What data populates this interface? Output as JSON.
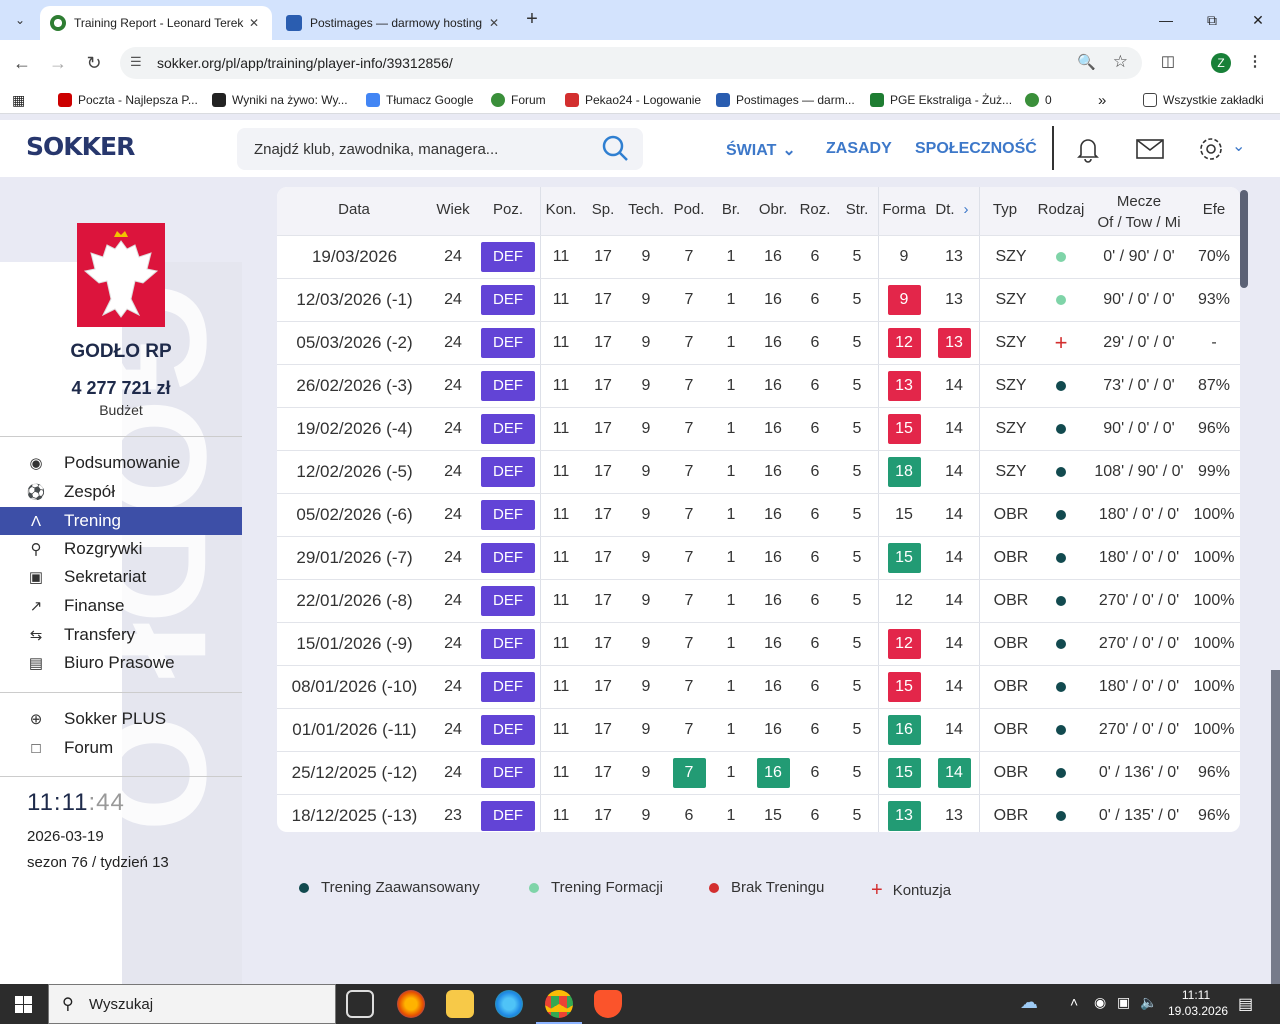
{
  "browser": {
    "tabs": [
      {
        "title": "Training Report - Leonard Terek",
        "active": true
      },
      {
        "title": "Postimages — darmowy hosting",
        "active": false
      }
    ],
    "url": "sokker.org/pl/app/training/player-info/39312856/",
    "profile_initial": "Z",
    "bookmarks": [
      {
        "label": "Poczta - Najlepsza P...",
        "icon": "wp-icon",
        "color": "#c00"
      },
      {
        "label": "Wyniki na żywo: Wy...",
        "icon": "livescore-icon",
        "color": "#222"
      },
      {
        "label": "Tłumacz Google",
        "icon": "translate-icon",
        "color": "#4285f4"
      },
      {
        "label": "Forum",
        "icon": "ball-icon",
        "color": "#3a8f3a"
      },
      {
        "label": "Pekao24 - Logowanie",
        "icon": "pekao-icon",
        "color": "#d32f2f"
      },
      {
        "label": "Postimages — darm...",
        "icon": "postimages-icon",
        "color": "#2a5db0"
      },
      {
        "label": "PGE Ekstraliga - Żuż...",
        "icon": "pge-icon",
        "color": "#1e7d32"
      },
      {
        "label": "0",
        "icon": "ball-icon",
        "color": "#3a8f3a"
      }
    ],
    "all_bookmarks_label": "Wszystkie zakładki"
  },
  "site": {
    "logo": "SOKKER",
    "search_placeholder": "Znajdź klub, zawodnika, managera...",
    "menu": {
      "world": "ŚWIAT",
      "rules": "ZASADY",
      "community": "SPOŁECZNOŚĆ"
    }
  },
  "sidebar": {
    "club_name": "GODŁO RP",
    "budget": "4 277 721 zł",
    "budget_label": "Budżet",
    "watermark": "GODŁO",
    "nav": [
      {
        "label": "Podsumowanie",
        "icon": "medal-icon"
      },
      {
        "label": "Zespół",
        "icon": "ball-icon"
      },
      {
        "label": "Trening",
        "icon": "cone-icon",
        "active": true
      },
      {
        "label": "Rozgrywki",
        "icon": "trophy-icon"
      },
      {
        "label": "Sekretariat",
        "icon": "briefcase-icon"
      },
      {
        "label": "Finanse",
        "icon": "chart-icon"
      },
      {
        "label": "Transfery",
        "icon": "transfer-icon"
      },
      {
        "label": "Biuro Prasowe",
        "icon": "newspaper-icon"
      }
    ],
    "nav2": [
      {
        "label": "Sokker PLUS",
        "icon": "plus-circle-icon"
      },
      {
        "label": "Forum",
        "icon": "chat-icon"
      }
    ],
    "clock": {
      "hm": "11:11",
      "sec": ":44"
    },
    "date": "2026-03-19",
    "season": "sezon 76 / tydzień 13"
  },
  "table": {
    "headers": {
      "date": "Data",
      "age": "Wiek",
      "pos": "Poz.",
      "stamina": "Kon.",
      "pace": "Sp.",
      "technique": "Tech.",
      "passing": "Pod.",
      "keeper": "Br.",
      "defender": "Obr.",
      "playmaker": "Roz.",
      "striker": "Str.",
      "form": "Forma",
      "tactical": "Dt.",
      "type": "Typ",
      "kind": "Rodzaj",
      "matches_l1": "Mecze",
      "matches_l2": "Of / Tow / Mi",
      "eff": "Efe"
    },
    "colors": {
      "pos": "#6244d6",
      "red": "#e3264a",
      "green": "#229b74",
      "dot_dark": "#124a4f",
      "dot_light": "#7fd4a8",
      "injury": "#d32f2f"
    },
    "rows": [
      {
        "date": "19/03/2026",
        "age": "24",
        "pos": "DEF",
        "kon": "11",
        "sp": "17",
        "tech": "9",
        "pod": {
          "v": "7"
        },
        "br": "1",
        "obr": {
          "v": "16"
        },
        "roz": "6",
        "str": "5",
        "forma": {
          "v": "9"
        },
        "dt": {
          "v": "13"
        },
        "typ": "SZY",
        "rodzaj": "light",
        "mecze": "0' / 90' / 0'",
        "efe": "70%"
      },
      {
        "date": "12/03/2026 (-1)",
        "age": "24",
        "pos": "DEF",
        "kon": "11",
        "sp": "17",
        "tech": "9",
        "pod": {
          "v": "7"
        },
        "br": "1",
        "obr": {
          "v": "16"
        },
        "roz": "6",
        "str": "5",
        "forma": {
          "v": "9",
          "c": "red"
        },
        "dt": {
          "v": "13"
        },
        "typ": "SZY",
        "rodzaj": "light",
        "mecze": "90' / 0' / 0'",
        "efe": "93%"
      },
      {
        "date": "05/03/2026 (-2)",
        "age": "24",
        "pos": "DEF",
        "kon": "11",
        "sp": "17",
        "tech": "9",
        "pod": {
          "v": "7"
        },
        "br": "1",
        "obr": {
          "v": "16"
        },
        "roz": "6",
        "str": "5",
        "forma": {
          "v": "12",
          "c": "red"
        },
        "dt": {
          "v": "13",
          "c": "red"
        },
        "typ": "SZY",
        "rodzaj": "injury",
        "mecze": "29' / 0' / 0'",
        "efe": "-"
      },
      {
        "date": "26/02/2026 (-3)",
        "age": "24",
        "pos": "DEF",
        "kon": "11",
        "sp": "17",
        "tech": "9",
        "pod": {
          "v": "7"
        },
        "br": "1",
        "obr": {
          "v": "16"
        },
        "roz": "6",
        "str": "5",
        "forma": {
          "v": "13",
          "c": "red"
        },
        "dt": {
          "v": "14"
        },
        "typ": "SZY",
        "rodzaj": "dark",
        "mecze": "73' / 0' / 0'",
        "efe": "87%"
      },
      {
        "date": "19/02/2026 (-4)",
        "age": "24",
        "pos": "DEF",
        "kon": "11",
        "sp": "17",
        "tech": "9",
        "pod": {
          "v": "7"
        },
        "br": "1",
        "obr": {
          "v": "16"
        },
        "roz": "6",
        "str": "5",
        "forma": {
          "v": "15",
          "c": "red"
        },
        "dt": {
          "v": "14"
        },
        "typ": "SZY",
        "rodzaj": "dark",
        "mecze": "90' / 0' / 0'",
        "efe": "96%"
      },
      {
        "date": "12/02/2026 (-5)",
        "age": "24",
        "pos": "DEF",
        "kon": "11",
        "sp": "17",
        "tech": "9",
        "pod": {
          "v": "7"
        },
        "br": "1",
        "obr": {
          "v": "16"
        },
        "roz": "6",
        "str": "5",
        "forma": {
          "v": "18",
          "c": "green"
        },
        "dt": {
          "v": "14"
        },
        "typ": "SZY",
        "rodzaj": "dark",
        "mecze": "108' / 90' / 0'",
        "efe": "99%"
      },
      {
        "date": "05/02/2026 (-6)",
        "age": "24",
        "pos": "DEF",
        "kon": "11",
        "sp": "17",
        "tech": "9",
        "pod": {
          "v": "7"
        },
        "br": "1",
        "obr": {
          "v": "16"
        },
        "roz": "6",
        "str": "5",
        "forma": {
          "v": "15"
        },
        "dt": {
          "v": "14"
        },
        "typ": "OBR",
        "rodzaj": "dark",
        "mecze": "180' / 0' / 0'",
        "efe": "100%"
      },
      {
        "date": "29/01/2026 (-7)",
        "age": "24",
        "pos": "DEF",
        "kon": "11",
        "sp": "17",
        "tech": "9",
        "pod": {
          "v": "7"
        },
        "br": "1",
        "obr": {
          "v": "16"
        },
        "roz": "6",
        "str": "5",
        "forma": {
          "v": "15",
          "c": "green"
        },
        "dt": {
          "v": "14"
        },
        "typ": "OBR",
        "rodzaj": "dark",
        "mecze": "180' / 0' / 0'",
        "efe": "100%"
      },
      {
        "date": "22/01/2026 (-8)",
        "age": "24",
        "pos": "DEF",
        "kon": "11",
        "sp": "17",
        "tech": "9",
        "pod": {
          "v": "7"
        },
        "br": "1",
        "obr": {
          "v": "16"
        },
        "roz": "6",
        "str": "5",
        "forma": {
          "v": "12"
        },
        "dt": {
          "v": "14"
        },
        "typ": "OBR",
        "rodzaj": "dark",
        "mecze": "270' / 0' / 0'",
        "efe": "100%"
      },
      {
        "date": "15/01/2026 (-9)",
        "age": "24",
        "pos": "DEF",
        "kon": "11",
        "sp": "17",
        "tech": "9",
        "pod": {
          "v": "7"
        },
        "br": "1",
        "obr": {
          "v": "16"
        },
        "roz": "6",
        "str": "5",
        "forma": {
          "v": "12",
          "c": "red"
        },
        "dt": {
          "v": "14"
        },
        "typ": "OBR",
        "rodzaj": "dark",
        "mecze": "270' / 0' / 0'",
        "efe": "100%"
      },
      {
        "date": "08/01/2026 (-10)",
        "age": "24",
        "pos": "DEF",
        "kon": "11",
        "sp": "17",
        "tech": "9",
        "pod": {
          "v": "7"
        },
        "br": "1",
        "obr": {
          "v": "16"
        },
        "roz": "6",
        "str": "5",
        "forma": {
          "v": "15",
          "c": "red"
        },
        "dt": {
          "v": "14"
        },
        "typ": "OBR",
        "rodzaj": "dark",
        "mecze": "180' / 0' / 0'",
        "efe": "100%"
      },
      {
        "date": "01/01/2026 (-11)",
        "age": "24",
        "pos": "DEF",
        "kon": "11",
        "sp": "17",
        "tech": "9",
        "pod": {
          "v": "7"
        },
        "br": "1",
        "obr": {
          "v": "16"
        },
        "roz": "6",
        "str": "5",
        "forma": {
          "v": "16",
          "c": "green"
        },
        "dt": {
          "v": "14"
        },
        "typ": "OBR",
        "rodzaj": "dark",
        "mecze": "270' / 0' / 0'",
        "efe": "100%"
      },
      {
        "date": "25/12/2025 (-12)",
        "age": "24",
        "pos": "DEF",
        "kon": "11",
        "sp": "17",
        "tech": "9",
        "pod": {
          "v": "7",
          "c": "green"
        },
        "br": "1",
        "obr": {
          "v": "16",
          "c": "green"
        },
        "roz": "6",
        "str": "5",
        "forma": {
          "v": "15",
          "c": "green"
        },
        "dt": {
          "v": "14",
          "c": "green"
        },
        "typ": "OBR",
        "rodzaj": "dark",
        "mecze": "0' / 136' / 0'",
        "efe": "96%"
      },
      {
        "date": "18/12/2025 (-13)",
        "age": "23",
        "pos": "DEF",
        "kon": "11",
        "sp": "17",
        "tech": "9",
        "pod": {
          "v": "6"
        },
        "br": "1",
        "obr": {
          "v": "15"
        },
        "roz": "6",
        "str": "5",
        "forma": {
          "v": "13",
          "c": "green"
        },
        "dt": {
          "v": "13"
        },
        "typ": "OBR",
        "rodzaj": "dark",
        "mecze": "0' / 135' / 0'",
        "efe": "96%"
      }
    ]
  },
  "legend": [
    {
      "label": "Trening Zaawansowany",
      "kind": "dark"
    },
    {
      "label": "Trening Formacji",
      "kind": "light"
    },
    {
      "label": "Brak Treningu",
      "kind": "none"
    },
    {
      "label": "Kontuzja",
      "kind": "injury"
    }
  ],
  "taskbar": {
    "search_placeholder": "Wyszukaj",
    "time": "11:11",
    "date": "19.03.2026"
  }
}
